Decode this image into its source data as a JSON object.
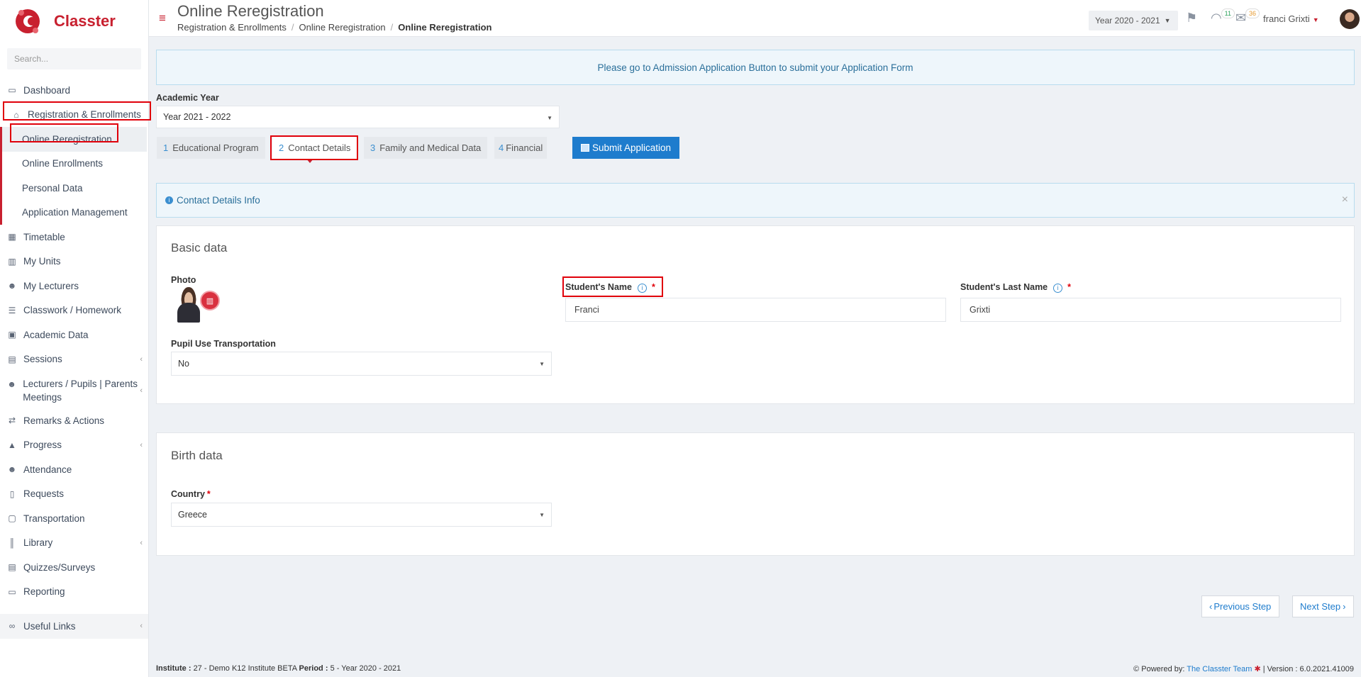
{
  "app": {
    "name": "Classter"
  },
  "sidebar": {
    "search_placeholder": "Search...",
    "items": [
      {
        "label": "Dashboard",
        "icon": "laptop-icon"
      },
      {
        "label": "Registration & Enrollments",
        "icon": "bank-icon"
      },
      {
        "label": "Timetable",
        "icon": "calendar-icon"
      },
      {
        "label": "My Units",
        "icon": "book-icon"
      },
      {
        "label": "My Lecturers",
        "icon": "users-icon"
      },
      {
        "label": "Classwork / Homework",
        "icon": "list-icon"
      },
      {
        "label": "Academic Data",
        "icon": "id-card-icon"
      },
      {
        "label": "Sessions",
        "icon": "presentation-icon"
      },
      {
        "label": "Lecturers / Pupils | Parents Meetings",
        "icon": "meeting-icon"
      },
      {
        "label": "Remarks & Actions",
        "icon": "shuffle-icon"
      },
      {
        "label": "Progress",
        "icon": "graduation-cap-icon"
      },
      {
        "label": "Attendance",
        "icon": "user-check-icon"
      },
      {
        "label": "Requests",
        "icon": "document-icon"
      },
      {
        "label": "Transportation",
        "icon": "bus-icon"
      },
      {
        "label": "Library",
        "icon": "library-icon"
      },
      {
        "label": "Quizzes/Surveys",
        "icon": "quiz-icon"
      },
      {
        "label": "Reporting",
        "icon": "printer-icon"
      },
      {
        "label": "Useful Links",
        "icon": "link-icon"
      }
    ],
    "sub_items": [
      {
        "label": "Online Reregistration"
      },
      {
        "label": "Online Enrollments"
      },
      {
        "label": "Personal Data"
      },
      {
        "label": "Application Management"
      }
    ]
  },
  "header": {
    "title": "Online Reregistration",
    "breadcrumb": [
      "Registration & Enrollments",
      "Online Reregistration",
      "Online Reregistration"
    ],
    "year_select": "Year 2020 - 2021",
    "notifications_count": "11",
    "messages_count": "36",
    "user_name": "franci Grixti"
  },
  "main": {
    "notice": "Please go to Admission Application Button to submit your Application Form",
    "academic_year_label": "Academic Year",
    "academic_year_value": "Year 2021 - 2022",
    "tabs": [
      {
        "num": "1",
        "label": "Educational Program"
      },
      {
        "num": "2",
        "label": "Contact Details"
      },
      {
        "num": "3",
        "label": "Family and Medical Data"
      },
      {
        "num": "4",
        "label": "Financial"
      }
    ],
    "submit_label": "Submit Application",
    "info_bar": "Contact Details Info",
    "basic": {
      "title": "Basic data",
      "photo_label": "Photo",
      "name_label": "Student's Name",
      "name_value": "Franci",
      "last_name_label": "Student's Last Name",
      "last_name_value": "Grixti",
      "transport_label": "Pupil Use Transportation",
      "transport_value": "No"
    },
    "birth": {
      "title": "Birth data",
      "country_label": "Country",
      "country_value": "Greece"
    },
    "prev_label": "Previous Step",
    "next_label": "Next Step"
  },
  "footer": {
    "institute_label": "Institute :",
    "institute_value": "27 - Demo K12 Institute BETA",
    "period_label": "Period :",
    "period_value": "5 - Year 2020 - 2021",
    "powered_label": "Powered by:",
    "powered_link": "The Classter Team",
    "version": "| Version : 6.0.2021.41009"
  },
  "colors": {
    "brand": "#c8202f",
    "accent": "#1e7ccd",
    "required": "#e0000a"
  }
}
